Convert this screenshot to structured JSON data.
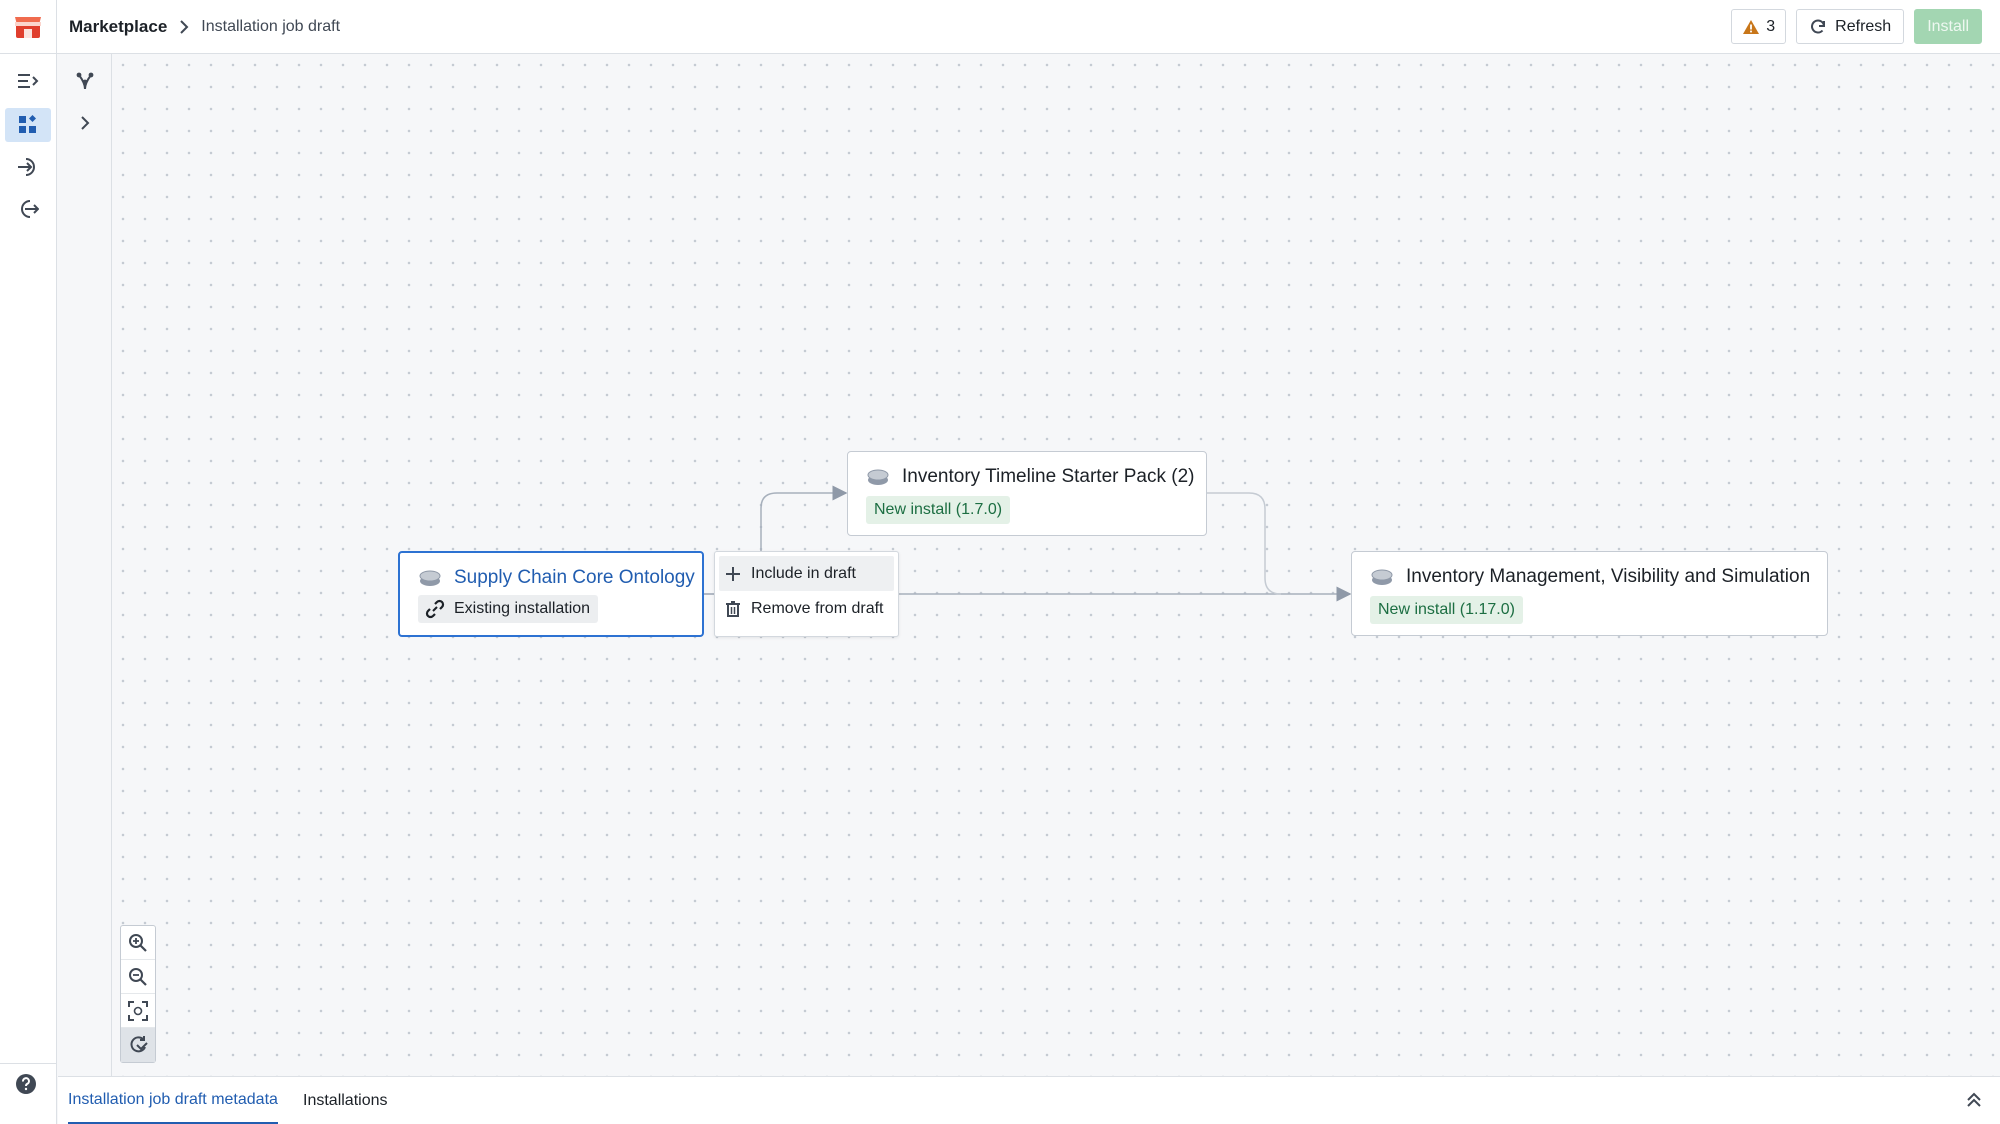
{
  "header": {
    "breadcrumb_root": "Marketplace",
    "breadcrumb_current": "Installation job draft",
    "warning_count": "3",
    "refresh_label": "Refresh",
    "install_label": "Install"
  },
  "graph": {
    "nodes": [
      {
        "title": "Supply Chain Core Ontology",
        "tag": "Existing installation",
        "status": "selected"
      },
      {
        "title": "Inventory Timeline Starter Pack (2)",
        "tag": "New install (1.7.0)"
      },
      {
        "title": "Inventory Management, Visibility and Simulation",
        "tag": "New install (1.17.0)"
      }
    ],
    "context_menu": [
      {
        "label": "Include in draft",
        "icon": "plus-icon"
      },
      {
        "label": "Remove from draft",
        "icon": "trash-icon"
      }
    ]
  },
  "zoom_controls": [
    "zoom-in-icon",
    "zoom-out-icon",
    "fit-view-icon",
    "auto-layout-icon"
  ],
  "bottom_tabs": [
    {
      "label": "Installation job draft metadata",
      "active": true
    },
    {
      "label": "Installations",
      "active": false
    }
  ],
  "colors": {
    "accent": "#2d72d2",
    "install_disabled": "#a3d6b2",
    "tag_green_bg": "#e4f1e7",
    "tag_green_text": "#1c6e42",
    "warning": "#c87619"
  }
}
